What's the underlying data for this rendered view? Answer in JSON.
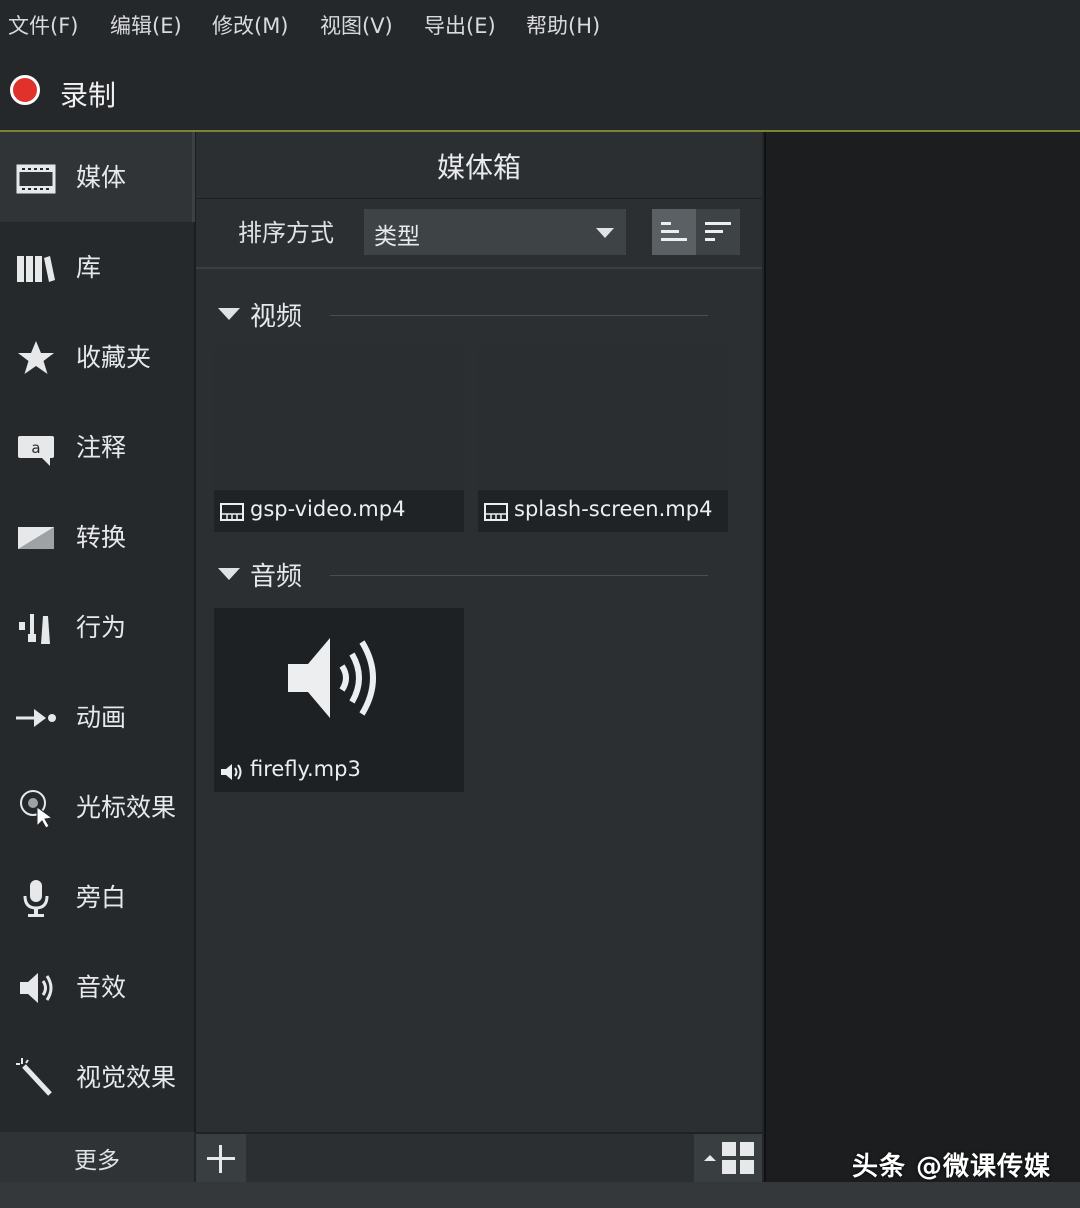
{
  "menu": [
    "文件(F)",
    "编辑(E)",
    "修改(M)",
    "视图(V)",
    "导出(E)",
    "帮助(H)"
  ],
  "record": {
    "label": "录制",
    "color": "#e0322b"
  },
  "sidebar": {
    "items": [
      {
        "label": "媒体",
        "icon": "film-strip-icon"
      },
      {
        "label": "库",
        "icon": "library-books-icon"
      },
      {
        "label": "收藏夹",
        "icon": "star-icon"
      },
      {
        "label": "注释",
        "icon": "callout-icon"
      },
      {
        "label": "转换",
        "icon": "transition-icon"
      },
      {
        "label": "行为",
        "icon": "behaviors-icon"
      },
      {
        "label": "动画",
        "icon": "animation-arrow-icon"
      },
      {
        "label": "光标效果",
        "icon": "cursor-effect-icon"
      },
      {
        "label": "旁白",
        "icon": "microphone-icon"
      },
      {
        "label": "音效",
        "icon": "speaker-icon"
      },
      {
        "label": "视觉效果",
        "icon": "magic-wand-icon"
      }
    ],
    "more_label": "更多"
  },
  "bin": {
    "title": "媒体箱",
    "sort_label": "排序方式",
    "sort_value": "类型",
    "sections": {
      "video": {
        "label": "视频",
        "items": [
          {
            "name": "gsp-video.mp4",
            "icon": "video-file-icon"
          },
          {
            "name": "splash-screen.mp4",
            "icon": "video-file-icon"
          }
        ]
      },
      "audio": {
        "label": "音频",
        "items": [
          {
            "name": "firefly.mp3",
            "icon": "speaker-icon"
          }
        ]
      }
    }
  },
  "watermark": "头条 @微课传媒",
  "colors": {
    "accent_line": "#7a8431",
    "background": "#232629",
    "record_red": "#e0322b"
  }
}
